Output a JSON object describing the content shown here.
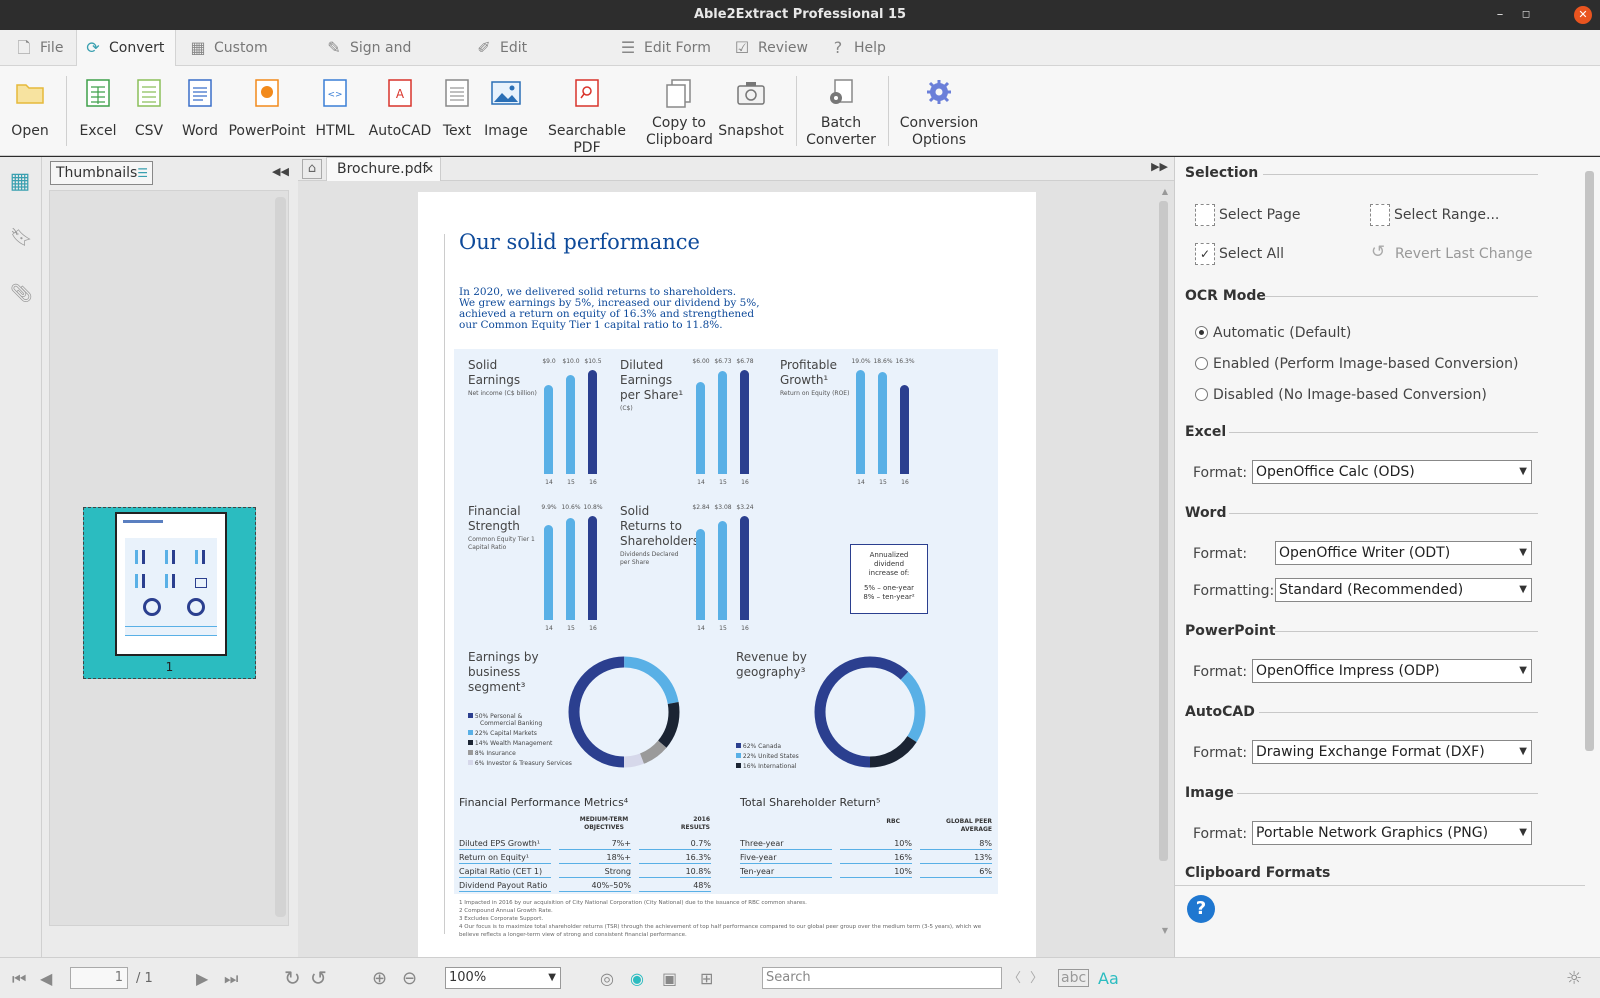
{
  "app": {
    "title": "Able2Extract Professional 15"
  },
  "menu": {
    "tabs": [
      "File",
      "Convert",
      "Custom Excel",
      "Sign and Secure",
      "Edit Document",
      "Edit Form",
      "Review",
      "Help"
    ]
  },
  "ribbon": {
    "open": "Open",
    "excel": "Excel",
    "csv": "CSV",
    "word": "Word",
    "powerpoint": "PowerPoint",
    "html": "HTML",
    "autocad": "AutoCAD",
    "text": "Text",
    "image": "Image",
    "searchable_pdf": "Searchable PDF",
    "copy1": "Copy to",
    "copy2": "Clipboard",
    "snapshot": "Snapshot",
    "batch1": "Batch",
    "batch2": "Converter",
    "conv1": "Conversion",
    "conv2": "Options"
  },
  "thumbs": {
    "selector": "Thumbnails",
    "page_number": "1"
  },
  "doc_tab": {
    "name": "Brochure.pdf"
  },
  "pdf": {
    "title": "Our solid performance",
    "intro": [
      "In 2020, we delivered solid returns to shareholders.",
      "We grew earnings by 5%, increased our dividend by 5%,",
      "achieved a return on equity of 16.3% and strengthened",
      "our Common Equity Tier 1 capital ratio to 11.8%."
    ],
    "charts": [
      {
        "title": [
          "Solid",
          "Earnings"
        ],
        "sub": "Net income (C$ billion)",
        "labels": [
          "$9.0",
          "$10.0",
          "$10.5"
        ],
        "years": [
          "14",
          "15",
          "16"
        ],
        "values": [
          9.0,
          10.0,
          10.5
        ]
      },
      {
        "title": [
          "Diluted",
          "Earnings",
          "per Share¹"
        ],
        "sub": "(C$)",
        "labels": [
          "$6.00",
          "$6.73",
          "$6.78"
        ],
        "years": [
          "14",
          "15",
          "16"
        ],
        "values": [
          6.0,
          6.73,
          6.78
        ]
      },
      {
        "title": [
          "Profitable",
          "Growth¹"
        ],
        "sub": "Return on Equity (ROE)",
        "labels": [
          "19.0%",
          "18.6%",
          "16.3%"
        ],
        "years": [
          "14",
          "15",
          "16"
        ],
        "values": [
          19.0,
          18.6,
          16.3
        ]
      },
      {
        "title": [
          "Financial",
          "Strength"
        ],
        "sub": "Common Equity Tier 1 Capital Ratio",
        "labels": [
          "9.9%",
          "10.6%",
          "10.8%"
        ],
        "years": [
          "14",
          "15",
          "16"
        ],
        "values": [
          9.9,
          10.6,
          10.8
        ]
      },
      {
        "title": [
          "Solid",
          "Returns to",
          "Shareholders"
        ],
        "sub": "Dividends Declared per Share",
        "labels": [
          "$2.84",
          "$3.08",
          "$3.24"
        ],
        "years": [
          "14",
          "15",
          "16"
        ],
        "values": [
          2.84,
          3.08,
          3.24
        ]
      }
    ],
    "dividend_box": [
      "Annualized",
      "dividend",
      "increase of:",
      "5% – one-year",
      "8% – ten-year²"
    ],
    "donut1": {
      "title": [
        "Earnings by",
        "business",
        "segment³"
      ],
      "legend": [
        "50% Personal &",
        "Commercial Banking",
        "22% Capital Markets",
        "14% Wealth Management",
        "8%  Insurance",
        "6%  Investor & Treasury Services"
      ],
      "values": [
        50,
        22,
        14,
        8,
        6
      ]
    },
    "donut2": {
      "title": [
        "Revenue by",
        "geography³"
      ],
      "legend": [
        "62% Canada",
        "22% United States",
        "16% International"
      ],
      "values": [
        62,
        22,
        16
      ]
    },
    "fpm": {
      "title": "Financial Performance Metrics⁴",
      "h1": "MEDIUM-TERM",
      "h1b": "OBJECTIVES",
      "h2": "2016",
      "h2b": "RESULTS",
      "rows": [
        [
          "Diluted EPS Growth¹",
          "7%+",
          "0.7%"
        ],
        [
          "Return on Equity¹",
          "18%+",
          "16.3%"
        ],
        [
          "Capital Ratio (CET 1)",
          "Strong",
          "10.8%"
        ],
        [
          "Dividend Payout Ratio",
          "40%–50%",
          "48%"
        ]
      ]
    },
    "tsr": {
      "title": "Total Shareholder Return⁵",
      "h1": "RBC",
      "h2": "GLOBAL PEER",
      "h2b": "AVERAGE",
      "rows": [
        [
          "Three-year",
          "10%",
          "8%"
        ],
        [
          "Five-year",
          "16%",
          "13%"
        ],
        [
          "Ten-year",
          "10%",
          "6%"
        ]
      ]
    },
    "footnotes": [
      "1  Impacted in 2016 by our acquisition of City National Corporation (City National) due to the issuance of RBC common shares.",
      "2  Compound Annual Growth Rate.",
      "3  Excludes Corporate Support.",
      "4  Our focus is to maximize total shareholder returns (TSR) through the achievement of top half performance compared to our global peer group over the medium term (3-5 years), which we",
      "   believe reflects a longer-term view of strong and consistent financial performance."
    ]
  },
  "panel": {
    "selection": {
      "title": "Selection",
      "select_page": "Select Page",
      "select_range": "Select Range...",
      "select_all": "Select All",
      "revert": "Revert Last Change"
    },
    "ocr": {
      "title": "OCR Mode",
      "auto": "Automatic (Default)",
      "enabled": "Enabled (Perform Image-based Conversion)",
      "disabled": "Disabled (No Image-based Conversion)"
    },
    "excel": {
      "title": "Excel",
      "format_label": "Format:",
      "format": "OpenOffice Calc (ODS)"
    },
    "word": {
      "title": "Word",
      "format_label": "Format:",
      "format": "OpenOffice Writer (ODT)",
      "formatting_label": "Formatting:",
      "formatting": "Standard (Recommended)"
    },
    "powerpoint": {
      "title": "PowerPoint",
      "format_label": "Format:",
      "format": "OpenOffice Impress (ODP)"
    },
    "autocad": {
      "title": "AutoCAD",
      "format_label": "Format:",
      "format": "Drawing Exchange Format (DXF)"
    },
    "image": {
      "title": "Image",
      "format_label": "Format:",
      "format": "Portable Network Graphics (PNG)"
    },
    "clipboard": {
      "title": "Clipboard Formats"
    }
  },
  "status": {
    "page": "1",
    "total": "/ 1",
    "zoom": "100%",
    "search_placeholder": "Search",
    "abc": "abc",
    "aa": "Aa"
  },
  "colors": {
    "accent": "#2bbcc0",
    "title_bar": "#2d2d2d",
    "close": "#e9541f",
    "pdf_blue": "#0e4a9a",
    "bar_light": "#59b0e6",
    "bar_dark": "#2b3f8f",
    "help": "#1f77d0"
  }
}
